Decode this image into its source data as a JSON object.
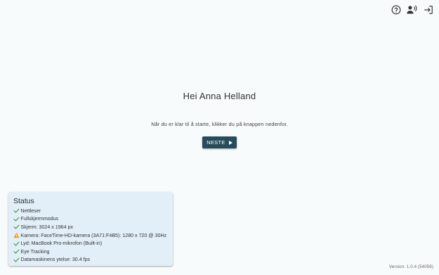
{
  "toolbar": {
    "icons": [
      "help-circle-icon",
      "voice-user-icon",
      "logout-icon"
    ]
  },
  "greeting": "Hei Anna Helland",
  "prompt": "Når du er klar til å starte, klikker du på knappen nedenfor.",
  "next_button": {
    "label": "NESTE",
    "color": "#264c5c"
  },
  "status": {
    "title": "Status",
    "background": "#e2eff8",
    "items": [
      {
        "label": "Nettleser",
        "state": "ok"
      },
      {
        "label": "Fullskjermmodus",
        "state": "ok"
      },
      {
        "label": "Skjerm: 3024 x 1964 px",
        "state": "ok"
      },
      {
        "label": "Kamera: FaceTime-HD-kamera (3A71:F4B5): 1280 x 720 @ 30Hz",
        "state": "warning"
      },
      {
        "label": "Lyd: MacBook Pro-mikrofon (Built-in)",
        "state": "ok"
      },
      {
        "label": "Eye Tracking",
        "state": "ok"
      },
      {
        "label": "Datamaskinens ytelse: 30.4 fps",
        "state": "ok"
      }
    ],
    "colors": {
      "ok": "#43a047",
      "warning": "#f59e0b"
    }
  },
  "version": "Version: 1.0.4 (54059)"
}
